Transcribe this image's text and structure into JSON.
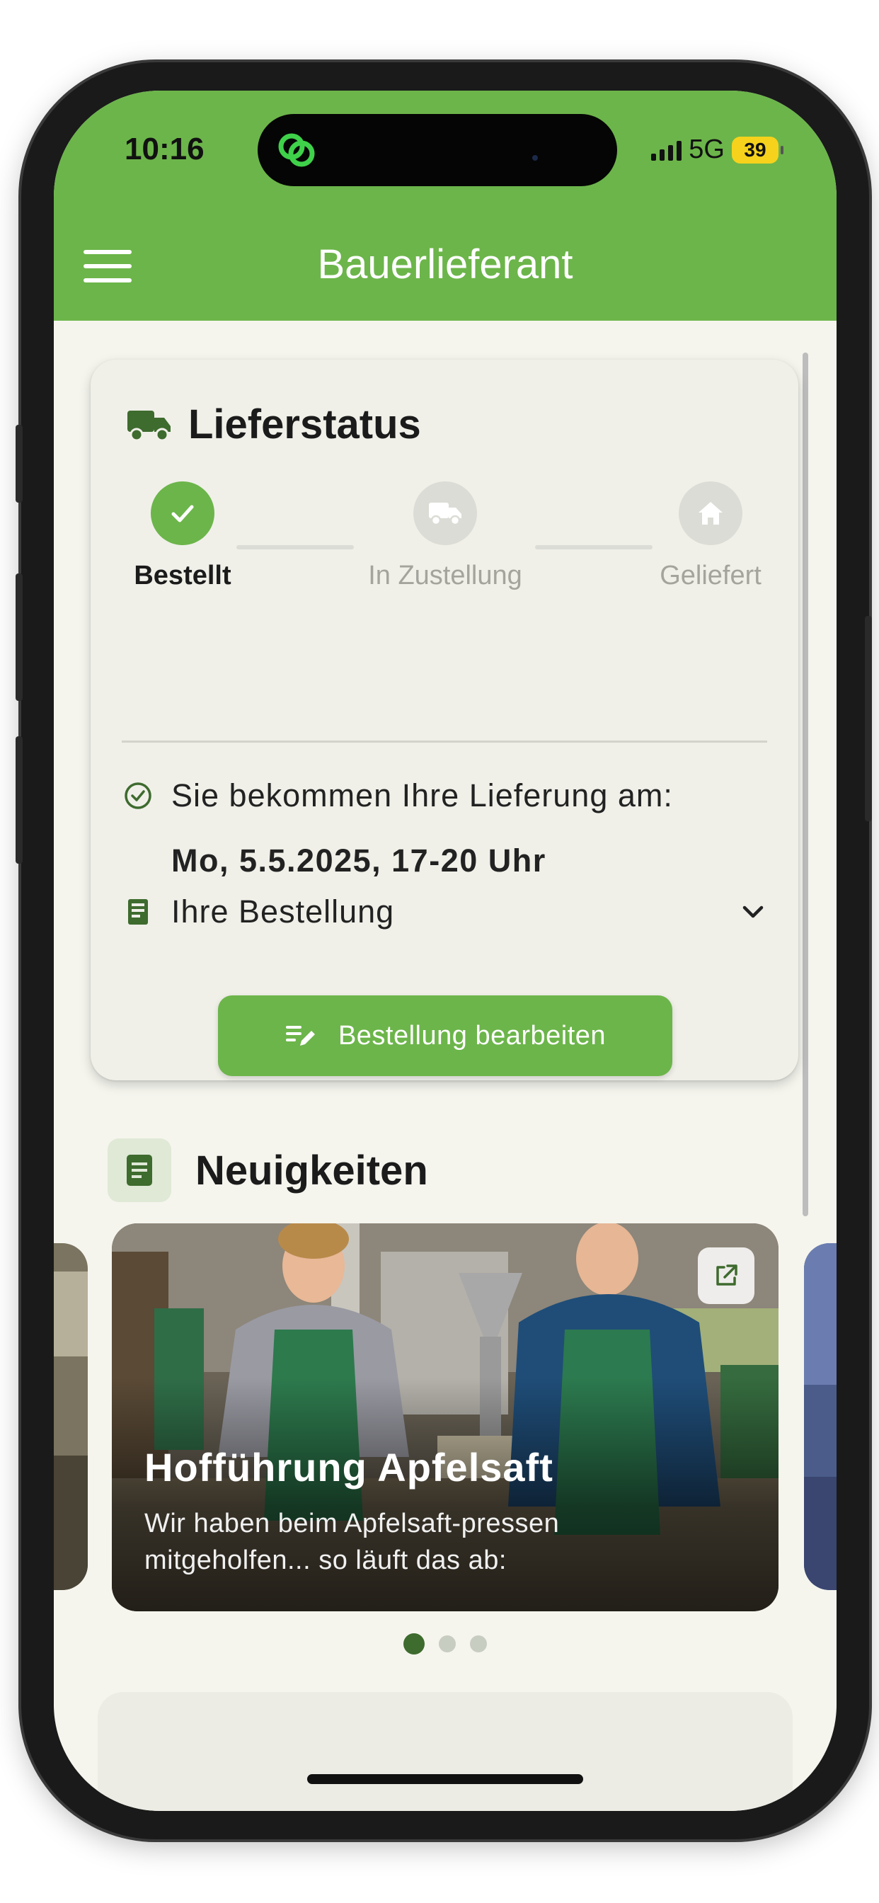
{
  "status_bar": {
    "time": "10:16",
    "network": "5G",
    "battery": "39"
  },
  "app_bar": {
    "title": "Bauerlieferant",
    "menu_icon": "hamburger-menu-icon"
  },
  "delivery_card": {
    "title": "Lieferstatus",
    "title_icon": "truck-icon",
    "steps": [
      {
        "label": "Bestellt",
        "icon": "check-icon",
        "state": "done"
      },
      {
        "label": "In Zustellung",
        "icon": "truck-icon",
        "state": "pending"
      },
      {
        "label": "Geliefert",
        "icon": "home-icon",
        "state": "pending"
      }
    ],
    "delivery_text": "Sie bekommen Ihre Lieferung am:",
    "delivery_date": "Mo, 5.5.2025, 17-20 Uhr",
    "order_label": "Ihre Bestellung",
    "edit_button": "Bestellung bearbeiten"
  },
  "news": {
    "title": "Neuigkeiten",
    "items": [
      {
        "title": "Hofführung Apfelsaft",
        "description": "Wir haben beim Apfelsaft-pressen mitgeholfen... so läuft das ab:"
      }
    ],
    "page_count": 3,
    "active_page": 0
  },
  "colors": {
    "brand_green": "#6cb54a",
    "dark_green": "#3e6b2e",
    "background": "#f5f5ee",
    "card": "#f0f0e9",
    "inactive_grey": "#dcdcd6",
    "battery_yellow": "#f6d21c"
  }
}
